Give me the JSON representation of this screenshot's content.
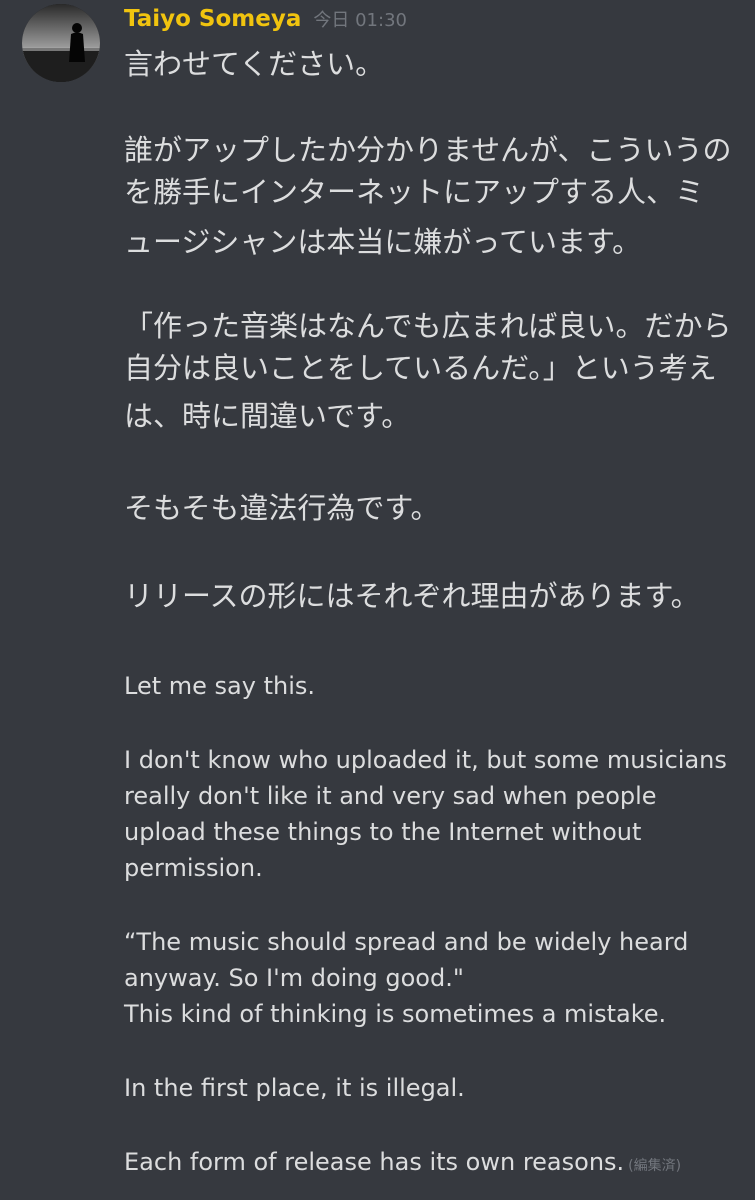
{
  "message": {
    "author": "Taiyo Someya",
    "timestamp": "今日 01:30",
    "author_color": "#f1c40f",
    "avatar_icon": "user-avatar-silhouette-at-sea",
    "jp": {
      "p1": "言わせてください。",
      "p2_l1": "誰がアップしたか分かりませんが、こういうの",
      "p2_l2": "を勝手にインターネットにアップする人、ミ",
      "p2_l3": "ュージシャンは本当に嫌がっています。",
      "p3_l1": "「作った音楽はなんでも広まれば良い。だから",
      "p3_l2": "自分は良いことをしているんだ。」という考え",
      "p3_l3": "は、時に間違いです。",
      "p4": "そもそも違法行為です。",
      "p5": "リリースの形にはそれぞれ理由があります。"
    },
    "en": {
      "p1": "Let me say this.",
      "p2_l1": "I don't know who uploaded it, but some musicians",
      "p2_l2": "really don't like it and very sad when people",
      "p2_l3": "upload these things to the Internet without",
      "p2_l4": "permission.",
      "p3_l1": "“The music should spread and be widely heard",
      "p3_l2": "anyway. So I'm doing good.\"",
      "p3_l3": "This kind of thinking is sometimes a mistake.",
      "p4": "In the first place, it is illegal.",
      "p5": "Each form of release has its own reasons."
    },
    "edited_label": "(編集済)"
  }
}
